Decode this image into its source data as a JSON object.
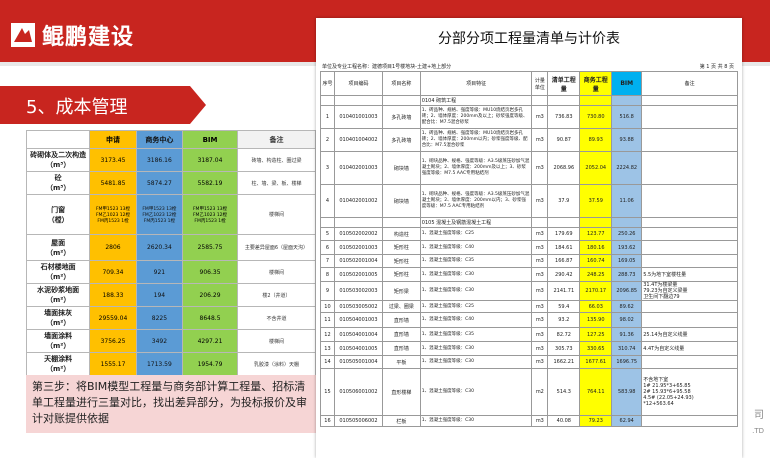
{
  "header": {
    "brand": "鲲鹏建设"
  },
  "section": {
    "title": "5、成本管理"
  },
  "comparison": {
    "headers": [
      "申请",
      "商务中心",
      "BIM",
      "备注"
    ],
    "rows": [
      {
        "label": "砖砌体及二次构造\n（m³）",
        "sq": "3173.45",
        "sw": "3186.16",
        "bim": "3187.04",
        "note": "砖墙、构造柱、圈过梁"
      },
      {
        "label": "砼\n（m³）",
        "sq": "5481.85",
        "sw": "5874.27",
        "bim": "5582.19",
        "note": "柱、墙、梁、板、楼梯"
      },
      {
        "label": "门窗\n（樘）",
        "sq": "FM甲1523 13樘\nFM乙1023 12樘\nFM丙1523 1樘",
        "sw": "FM甲1523 13樘\nFM乙1023 12樘\nFM丙1523 1樘",
        "bim": "FM甲1523 13樘\nFM乙1023 12樘\nFM丙1523 1樘",
        "note": "楼梯间"
      },
      {
        "label": "屋面\n（m²）",
        "sq": "2806",
        "sw": "2620.34",
        "bim": "2585.75",
        "note": "主要差异屋面6（屋面天沟）"
      },
      {
        "label": "石材楼地面\n（m²）",
        "sq": "709.34",
        "sw": "921",
        "bim": "906.35",
        "note": "楼梯间"
      },
      {
        "label": "水泥砂浆地面\n（m²）",
        "sq": "188.33",
        "sw": "194",
        "bim": "206.29",
        "note": "楼2（井道）"
      },
      {
        "label": "墙面抹灰\n（m²）",
        "sq": "29559.04",
        "sw": "8225",
        "bim": "8648.5",
        "note": "不含井道"
      },
      {
        "label": "墙面涂料\n（m²）",
        "sq": "3756.25",
        "sw": "3492",
        "bim": "4297.21",
        "note": "楼梯间"
      },
      {
        "label": "天棚涂料\n（m²）",
        "sq": "1555.17",
        "sw": "1713.59",
        "bim": "1954.79",
        "note": "乳胶漆（涂料）天棚"
      }
    ]
  },
  "caption": {
    "text": "第三步：将BIM模型工程量与商务部计算工程量、招标清单工程量进行三量对比，找出差异部分，为投标报价及审计对账提供依据"
  },
  "document": {
    "title": "分部分项工程量清单与计价表",
    "subtitle": "单位及专业工程名称：建德项目1号楼地块-土建+地上部分",
    "page": "第 1 页 共 8 页",
    "headers": [
      "序号",
      "项目编码",
      "项目名称",
      "项目特征",
      "计量单位",
      "清单工程量",
      "商务工程量",
      "BIM",
      "备注"
    ],
    "group1": "0104 砌筑工程",
    "group2": "0105 混凝土及钢筋混凝土工程",
    "rows": [
      {
        "no": "1",
        "code": "010401001003",
        "name": "多孔砖墙",
        "feat": "1、砖品种、规格、强度等级：MU10烧结页岩多孔砖；2、墙体厚度：200mm及以上；砂浆强度等级、配合比：M7.5混合砂浆",
        "unit": "m3",
        "bill": "736.83",
        "biz": "730.80",
        "bim": "516.8",
        "note": ""
      },
      {
        "no": "2",
        "code": "010401004002",
        "name": "多孔砖墙",
        "feat": "1、砖品种、规格、强度等级：MU10烧结页岩多孔砖；2、墙体厚度：200mm以内；砂浆强度等级、配合比：M7.5混合砂浆",
        "unit": "m3",
        "bill": "90.87",
        "biz": "89.93",
        "bim": "93.88",
        "note": ""
      },
      {
        "no": "3",
        "code": "010402001003",
        "name": "砌块墙",
        "feat": "1、砌块品种、规格、强度等级：A3.5级蒸压砂加气混凝土砌块；2、墙体厚度：200mm及以上；3、砂浆强度等级：M7.5 AAC专用粘结剂",
        "unit": "m3",
        "bill": "2068.96",
        "biz": "2052.04",
        "bim": "2224.82",
        "note": ""
      },
      {
        "no": "4",
        "code": "010402001002",
        "name": "砌块墙",
        "feat": "1、砌块品种、规格、强度等级：A3.5级蒸压砂加气混凝土砌块；2、墙体厚度：200mm以内；3、砂浆强度等级：M7.5 AAC专用粘结剂",
        "unit": "m3",
        "bill": "37.9",
        "biz": "37.59",
        "bim": "11.06",
        "note": ""
      },
      {
        "no": "5",
        "code": "010502002002",
        "name": "构造柱",
        "feat": "1、混凝土强度等级：C25",
        "unit": "m3",
        "bill": "179.69",
        "biz": "123.77",
        "bim": "250.26",
        "note": ""
      },
      {
        "no": "6",
        "code": "010502001003",
        "name": "矩形柱",
        "feat": "1、混凝土强度等级：C40",
        "unit": "m3",
        "bill": "184.61",
        "biz": "180.16",
        "bim": "193.62",
        "note": ""
      },
      {
        "no": "7",
        "code": "010502001004",
        "name": "矩形柱",
        "feat": "1、混凝土强度等级：C35",
        "unit": "m3",
        "bill": "166.87",
        "biz": "160.74",
        "bim": "169.05",
        "note": ""
      },
      {
        "no": "8",
        "code": "010502001005",
        "name": "矩形柱",
        "feat": "1、混凝土强度等级：C30",
        "unit": "m3",
        "bill": "290.42",
        "biz": "248.25",
        "bim": "288.73",
        "note": "5.5为地下室楼柱量"
      },
      {
        "no": "9",
        "code": "010503002003",
        "name": "矩形梁",
        "feat": "1、混凝土强度等级：C30",
        "unit": "m3",
        "bill": "2141.71",
        "biz": "2170.17",
        "bim": "2096.85",
        "note": "31.4T为楼梁量\n79.23为自定义梁量\n卫生间下翻边79"
      },
      {
        "no": "10",
        "code": "010503005002",
        "name": "过梁、圈梁",
        "feat": "1、混凝土强度等级：C25",
        "unit": "m3",
        "bill": "59.4",
        "biz": "66.03",
        "bim": "89.62",
        "note": ""
      },
      {
        "no": "11",
        "code": "010504001003",
        "name": "直形墙",
        "feat": "1、混凝土强度等级：C40",
        "unit": "m3",
        "bill": "93.2",
        "biz": "135.90",
        "bim": "98.02",
        "note": ""
      },
      {
        "no": "12",
        "code": "010504001004",
        "name": "直形墙",
        "feat": "1、混凝土强度等级：C35",
        "unit": "m3",
        "bill": "82.72",
        "biz": "127.25",
        "bim": "91.36",
        "note": "25.14为自定义线量"
      },
      {
        "no": "13",
        "code": "010504001005",
        "name": "直形墙",
        "feat": "1、混凝土强度等级：C30",
        "unit": "m3",
        "bill": "305.73",
        "biz": "330.65",
        "bim": "310.74",
        "note": "4.4T为自定义线量"
      },
      {
        "no": "14",
        "code": "010505001004",
        "name": "平板",
        "feat": "1、混凝土强度等级：C30",
        "unit": "m3",
        "bill": "1662.21",
        "biz": "1677.61",
        "bim": "1696.75",
        "note": ""
      },
      {
        "no": "15",
        "code": "010506001002",
        "name": "直形楼梯",
        "feat": "1、混凝土强度等级：C30",
        "unit": "m2",
        "bill": "514.3",
        "biz": "764.11",
        "bim": "583.98",
        "note": "不含地下室\n1# 21.95*3+65.85\n2# 15.93*6+95.58\n4.5# (22.05+24.93)\n*12+563.64"
      },
      {
        "no": "16",
        "code": "010505006002",
        "name": "栏板",
        "feat": "1、混凝土强度等级：C30",
        "unit": "m3",
        "bill": "40.08",
        "biz": "79.23",
        "bim": "62.94",
        "note": ""
      }
    ]
  },
  "corner": {
    "text1": "司",
    "text2": ".TD"
  }
}
